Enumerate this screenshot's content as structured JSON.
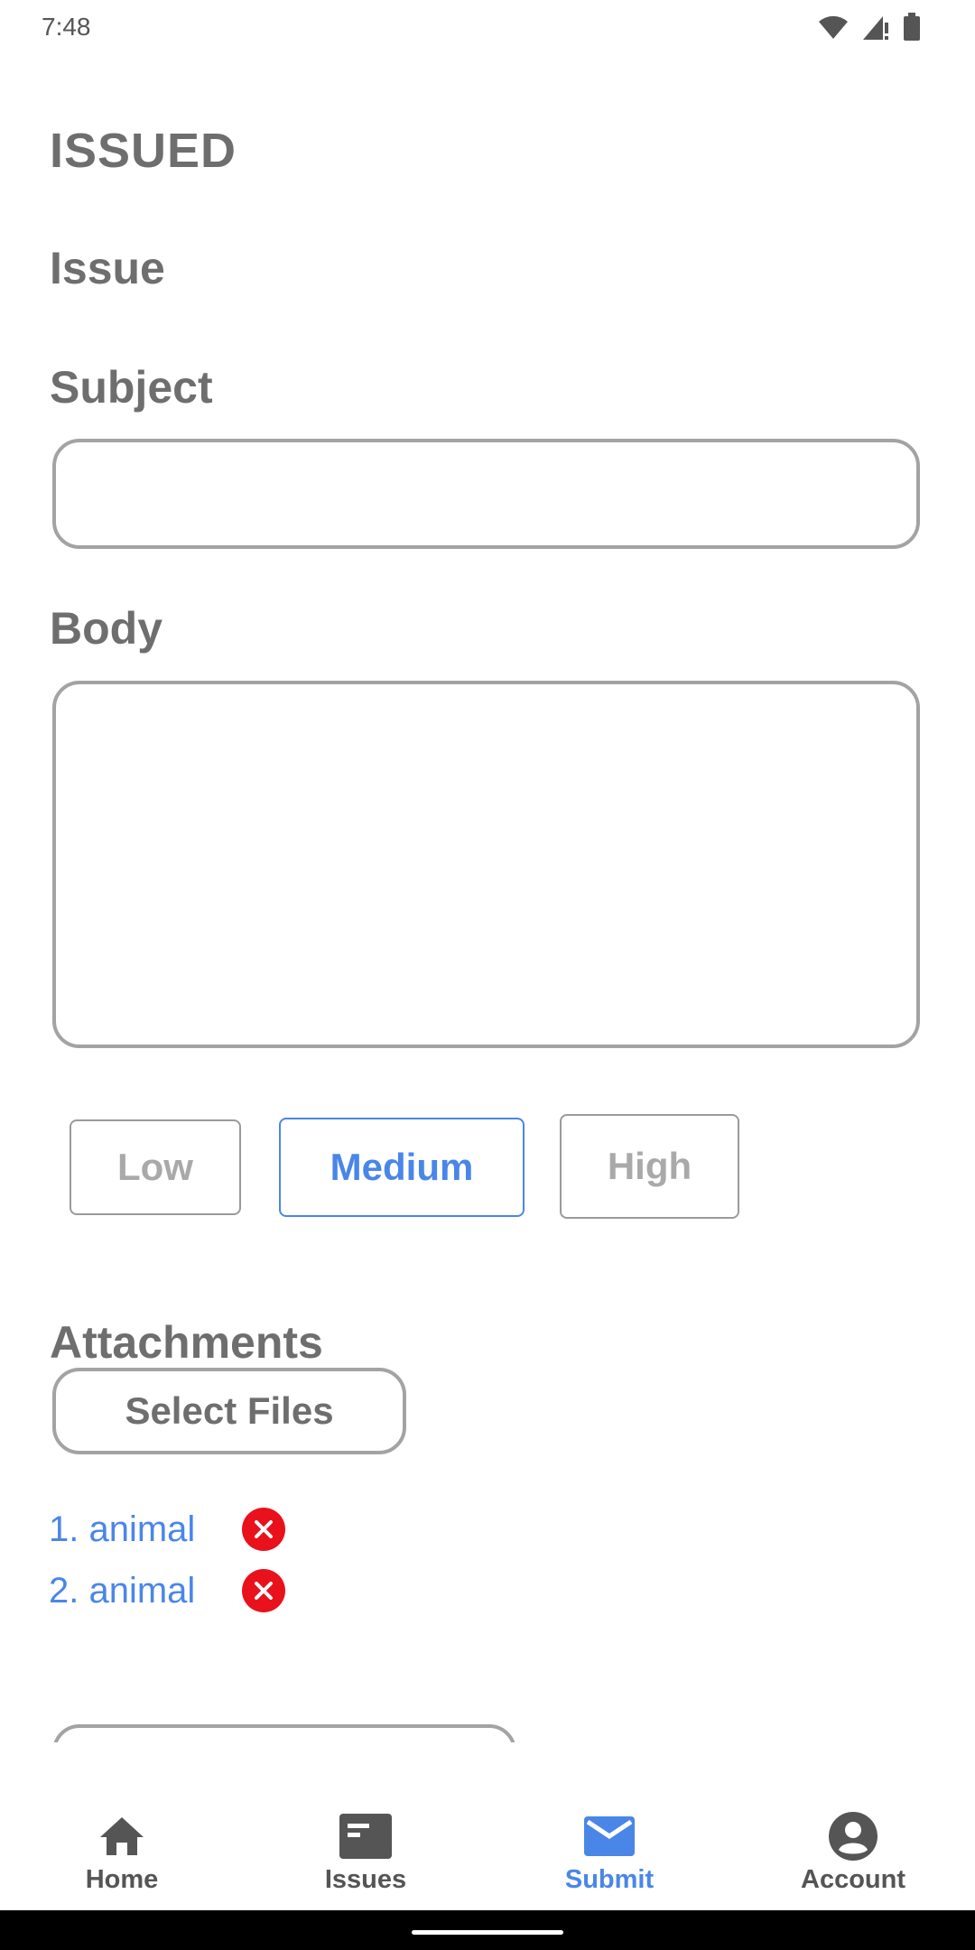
{
  "status_bar": {
    "time": "7:48",
    "icons": [
      "wifi-icon",
      "signal-icon",
      "battery-icon"
    ]
  },
  "app": {
    "title": "ISSUED"
  },
  "form": {
    "issue_heading": "Issue",
    "subject_label": "Subject",
    "subject_value": "",
    "body_label": "Body",
    "body_value": "",
    "priority": {
      "options": [
        "Low",
        "Medium",
        "High"
      ],
      "selected": "Medium"
    },
    "attachments_label": "Attachments",
    "select_files_label": "Select Files",
    "attachments": [
      {
        "label": "1. animal"
      },
      {
        "label": "2. animal"
      }
    ]
  },
  "bottom_nav": {
    "items": [
      {
        "label": "Home",
        "icon": "home-icon",
        "active": false
      },
      {
        "label": "Issues",
        "icon": "issues-icon",
        "active": false
      },
      {
        "label": "Submit",
        "icon": "mail-icon",
        "active": true
      },
      {
        "label": "Account",
        "icon": "account-icon",
        "active": false
      }
    ]
  },
  "colors": {
    "accent": "#4a86e8",
    "text_gray": "#6e6e6e",
    "border_gray": "#a3a3a3",
    "remove_red": "#e8111c"
  }
}
